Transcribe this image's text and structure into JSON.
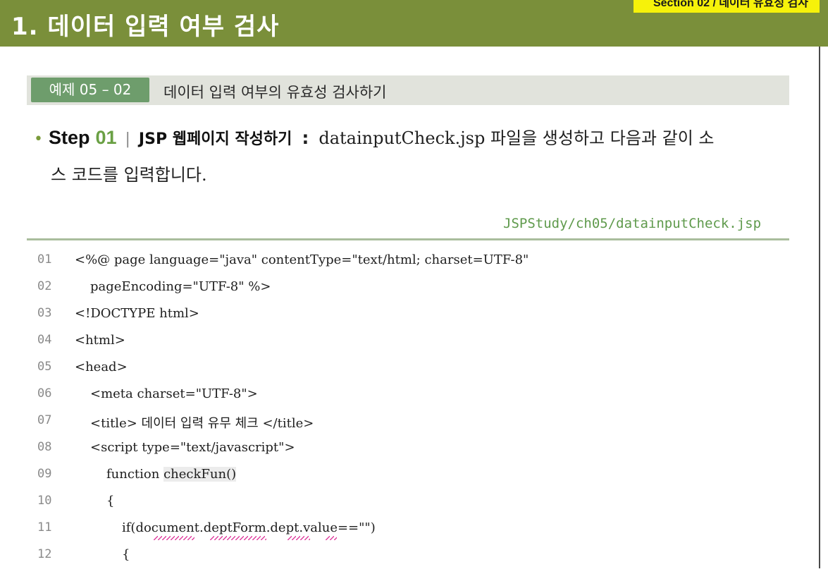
{
  "header": {
    "title": "1. 데이터 입력 여부 검사",
    "section_tag": "Section 02 / 데이터 유효성 검사"
  },
  "example": {
    "badge": "예제 05 – 02",
    "title": "데이터 입력 여부의 유효성 검사하기"
  },
  "step": {
    "bullet": "•",
    "word": "Step",
    "number": "01",
    "separator": "|",
    "heading": "JSP 웹페이지 작성하기",
    "colon": ":",
    "description_line1": "datainputCheck.jsp 파일을 생성하고 다음과 같이 소",
    "description_line2": "스 코드를 입력합니다."
  },
  "file_path": "JSPStudy/ch05/datainputCheck.jsp",
  "code": {
    "lines": [
      {
        "no": "01",
        "text": "<%@ page language=\"java\" contentType=\"text/html; charset=UTF-8\""
      },
      {
        "no": "02",
        "text": "pageEncoding=\"UTF-8\" %>"
      },
      {
        "no": "03",
        "text": "<!DOCTYPE html>"
      },
      {
        "no": "04",
        "text": "<html>"
      },
      {
        "no": "05",
        "text": "<head>"
      },
      {
        "no": "06",
        "text": "<meta charset=\"UTF-8\">"
      },
      {
        "no": "07",
        "text": "<title> 데이터 입력 유무 체크 </title>"
      },
      {
        "no": "08",
        "text": "<script type=\"text/javascript\">"
      },
      {
        "no": "09",
        "text_a": "function ",
        "text_b": "checkFun()"
      },
      {
        "no": "10",
        "text": "{"
      },
      {
        "no": "11",
        "text": "if(document.deptForm.dept.value==\"\")"
      },
      {
        "no": "12",
        "text": "{"
      }
    ]
  },
  "colors": {
    "header_bg": "#7a8f3a",
    "section_tag_bg": "#f6f20a",
    "badge_bg": "#6e9d6c",
    "example_bar_bg": "#e1e3dc",
    "path_color": "#5f9a4c",
    "squiggle": "#e040a0"
  }
}
